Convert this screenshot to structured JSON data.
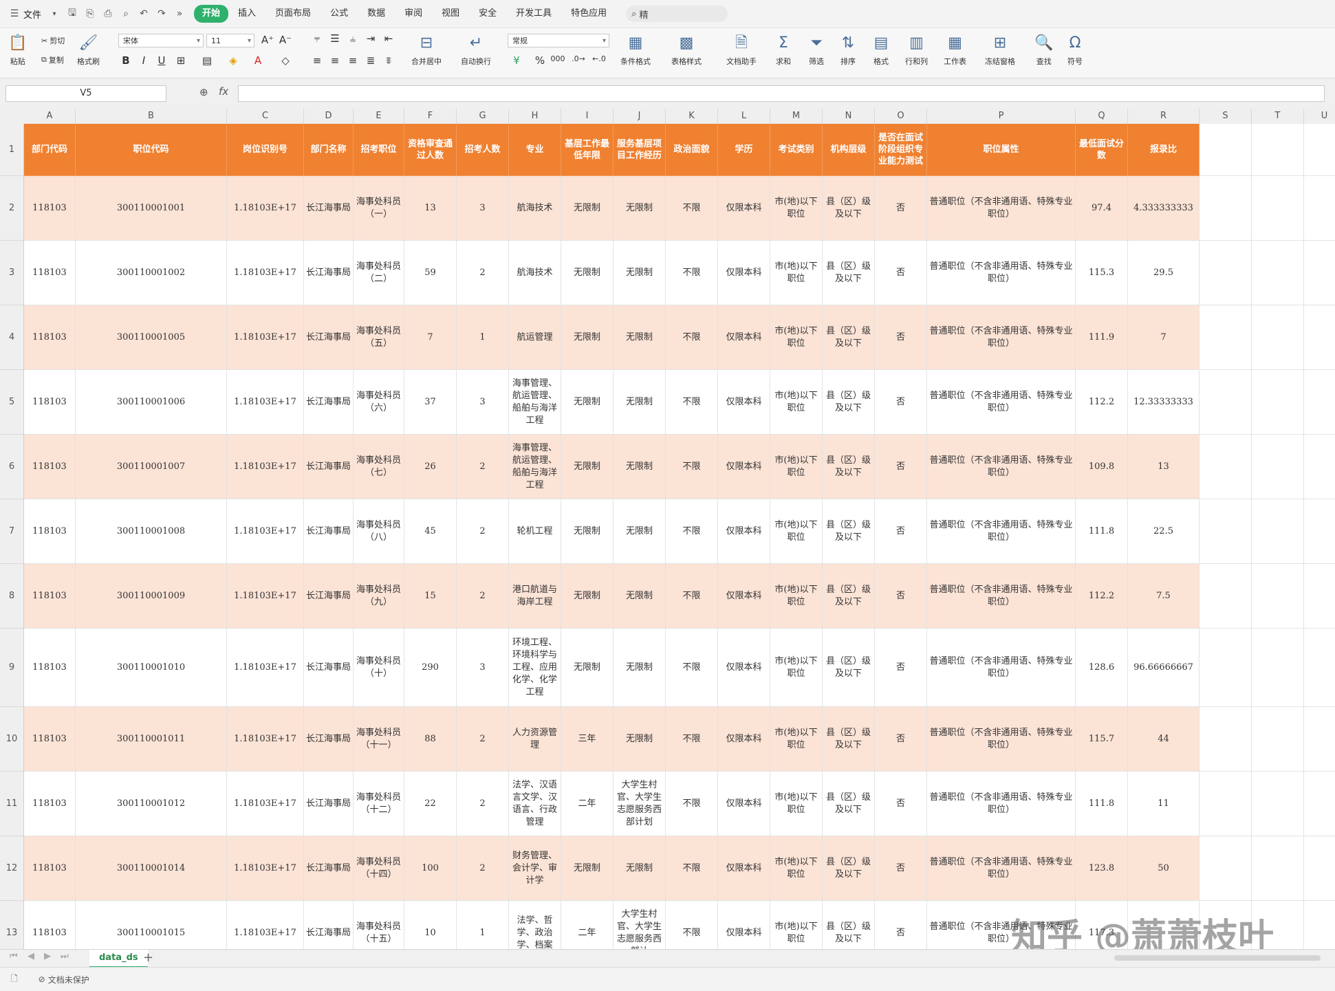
{
  "menubar": {
    "file_label": "文件",
    "tabs": [
      "开始",
      "插入",
      "页面布局",
      "公式",
      "数据",
      "审阅",
      "视图",
      "安全",
      "开发工具",
      "特色应用"
    ],
    "active_tab": "开始",
    "search_placeholder": "精"
  },
  "ribbon": {
    "paste": "粘贴",
    "cut": "剪切",
    "copy": "复制",
    "format_painter": "格式刷",
    "font_name": "宋体",
    "font_size": "11",
    "merge_center": "合并居中",
    "auto_wrap": "自动换行",
    "number_format": "常规",
    "conditional_format": "条件格式",
    "table_style": "表格样式",
    "doc_assistant": "文档助手",
    "sum": "求和",
    "filter": "筛选",
    "sort": "排序",
    "format": "格式",
    "row_col": "行和列",
    "worksheet": "工作表",
    "freeze": "冻结窗格",
    "find": "查找",
    "symbol": "符号"
  },
  "formula_bar": {
    "cell_ref": "V5",
    "fx_label": "fx",
    "value": ""
  },
  "columns": [
    "A",
    "B",
    "C",
    "D",
    "E",
    "F",
    "G",
    "H",
    "I",
    "J",
    "K",
    "L",
    "M",
    "N",
    "O",
    "P",
    "Q",
    "R",
    "S",
    "T",
    "U"
  ],
  "sheet": {
    "headers": [
      "部门代码",
      "职位代码",
      "岗位识别号",
      "部门名称",
      "招考职位",
      "资格审查通过人数",
      "招考人数",
      "专业",
      "基层工作最低年限",
      "服务基层项目工作经历",
      "政治面貌",
      "学历",
      "考试类别",
      "机构层级",
      "是否在面试阶段组织专业能力测试",
      "职位属性",
      "最低面试分数",
      "报录比"
    ],
    "rows": [
      [
        "118103",
        "300110001001",
        "1.18103E+17",
        "长江海事局",
        "海事处科员（一）",
        "13",
        "3",
        "航海技术",
        "无限制",
        "无限制",
        "不限",
        "仅限本科",
        "市(地)以下职位",
        "县（区）级及以下",
        "否",
        "普通职位（不含非通用语、特殊专业职位）",
        "97.4",
        "4.333333333"
      ],
      [
        "118103",
        "300110001002",
        "1.18103E+17",
        "长江海事局",
        "海事处科员（二）",
        "59",
        "2",
        "航海技术",
        "无限制",
        "无限制",
        "不限",
        "仅限本科",
        "市(地)以下职位",
        "县（区）级及以下",
        "否",
        "普通职位（不含非通用语、特殊专业职位）",
        "115.3",
        "29.5"
      ],
      [
        "118103",
        "300110001005",
        "1.18103E+17",
        "长江海事局",
        "海事处科员（五）",
        "7",
        "1",
        "航运管理",
        "无限制",
        "无限制",
        "不限",
        "仅限本科",
        "市(地)以下职位",
        "县（区）级及以下",
        "否",
        "普通职位（不含非通用语、特殊专业职位）",
        "111.9",
        "7"
      ],
      [
        "118103",
        "300110001006",
        "1.18103E+17",
        "长江海事局",
        "海事处科员（六）",
        "37",
        "3",
        "海事管理、航运管理、船舶与海洋工程",
        "无限制",
        "无限制",
        "不限",
        "仅限本科",
        "市(地)以下职位",
        "县（区）级及以下",
        "否",
        "普通职位（不含非通用语、特殊专业职位）",
        "112.2",
        "12.33333333"
      ],
      [
        "118103",
        "300110001007",
        "1.18103E+17",
        "长江海事局",
        "海事处科员（七）",
        "26",
        "2",
        "海事管理、航运管理、船舶与海洋工程",
        "无限制",
        "无限制",
        "不限",
        "仅限本科",
        "市(地)以下职位",
        "县（区）级及以下",
        "否",
        "普通职位（不含非通用语、特殊专业职位）",
        "109.8",
        "13"
      ],
      [
        "118103",
        "300110001008",
        "1.18103E+17",
        "长江海事局",
        "海事处科员（八）",
        "45",
        "2",
        "轮机工程",
        "无限制",
        "无限制",
        "不限",
        "仅限本科",
        "市(地)以下职位",
        "县（区）级及以下",
        "否",
        "普通职位（不含非通用语、特殊专业职位）",
        "111.8",
        "22.5"
      ],
      [
        "118103",
        "300110001009",
        "1.18103E+17",
        "长江海事局",
        "海事处科员（九）",
        "15",
        "2",
        "港口航道与海岸工程",
        "无限制",
        "无限制",
        "不限",
        "仅限本科",
        "市(地)以下职位",
        "县（区）级及以下",
        "否",
        "普通职位（不含非通用语、特殊专业职位）",
        "112.2",
        "7.5"
      ],
      [
        "118103",
        "300110001010",
        "1.18103E+17",
        "长江海事局",
        "海事处科员（十）",
        "290",
        "3",
        "环境工程、环境科学与工程、应用化学、化学工程",
        "无限制",
        "无限制",
        "不限",
        "仅限本科",
        "市(地)以下职位",
        "县（区）级及以下",
        "否",
        "普通职位（不含非通用语、特殊专业职位）",
        "128.6",
        "96.66666667"
      ],
      [
        "118103",
        "300110001011",
        "1.18103E+17",
        "长江海事局",
        "海事处科员（十一）",
        "88",
        "2",
        "人力资源管理",
        "三年",
        "无限制",
        "不限",
        "仅限本科",
        "市(地)以下职位",
        "县（区）级及以下",
        "否",
        "普通职位（不含非通用语、特殊专业职位）",
        "115.7",
        "44"
      ],
      [
        "118103",
        "300110001012",
        "1.18103E+17",
        "长江海事局",
        "海事处科员（十二）",
        "22",
        "2",
        "法学、汉语言文学、汉语言、行政管理",
        "二年",
        "大学生村官、大学生志愿服务西部计划",
        "不限",
        "仅限本科",
        "市(地)以下职位",
        "县（区）级及以下",
        "否",
        "普通职位（不含非通用语、特殊专业职位）",
        "111.8",
        "11"
      ],
      [
        "118103",
        "300110001014",
        "1.18103E+17",
        "长江海事局",
        "海事处科员（十四）",
        "100",
        "2",
        "财务管理、会计学、审计学",
        "无限制",
        "无限制",
        "不限",
        "仅限本科",
        "市(地)以下职位",
        "县（区）级及以下",
        "否",
        "普通职位（不含非通用语、特殊专业职位）",
        "123.8",
        "50"
      ],
      [
        "118103",
        "300110001015",
        "1.18103E+17",
        "长江海事局",
        "海事处科员（十五）",
        "10",
        "1",
        "法学、哲学、政治学、档案",
        "二年",
        "大学生村官、大学生志愿服务西部计",
        "不限",
        "仅限本科",
        "市(地)以下职位",
        "县（区）级及以下",
        "否",
        "普通职位（不含非通用语、特殊专业职位）",
        "117.3",
        ""
      ]
    ]
  },
  "sheet_tab": "data_ds",
  "status": "文档未保护",
  "watermark": "知乎 @萧萧枝叶"
}
